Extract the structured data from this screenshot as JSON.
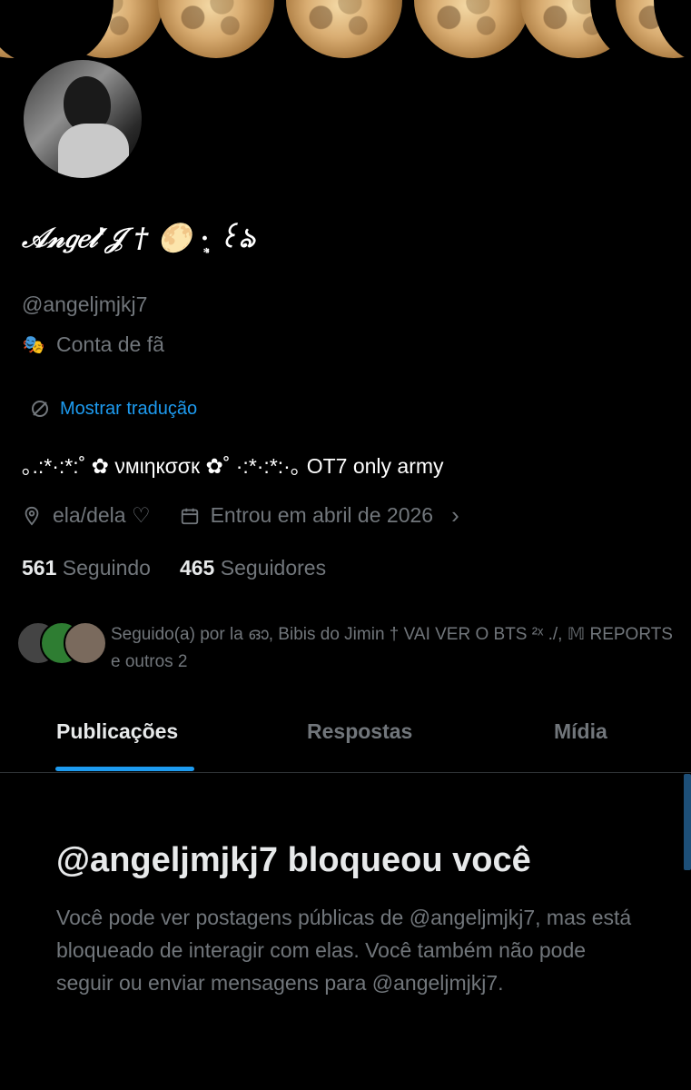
{
  "profile": {
    "display_name": "𝒜𝓃𝑔𝑒𝓁'𝒥 † 🌕 ·̩͙ ꒰ঌ",
    "handle": "@angeljmjkj7",
    "category": {
      "icon": "theater-mask-icon",
      "label": "Conta de fã"
    },
    "translate_label": "Mostrar tradução",
    "bio": "｡.:*·:*:˚ ✿ νмιηкσσк ✿˚ ·:*·:*:·｡ OT7  only army",
    "location": "ela/dela ♡",
    "joined": "Entrou em abril de 2026",
    "following_count": "561",
    "following_label": "Seguindo",
    "followers_count": "465",
    "followers_label": "Seguidores"
  },
  "followed_by": {
    "text": "Seguido(a) por la ഓ, Bibis do Jimin † VAI VER O BTS ²ˣ ./, 𝕄 REPORTS e outros 2",
    "avatar_colors": [
      "#333",
      "#2e7d32",
      "#7a6a5d"
    ]
  },
  "tabs": [
    {
      "label": "Publicações",
      "active": true
    },
    {
      "label": "Respostas",
      "active": false
    },
    {
      "label": "Mídia",
      "active": false
    }
  ],
  "blocked": {
    "title": "@angeljmjkj7 bloqueou você",
    "text": "Você pode ver postagens públicas de @angeljmjkj7, mas está bloqueado de interagir com elas. Você também não pode seguir ou enviar mensagens para @angeljmjkj7."
  },
  "colors": {
    "accent": "#1d9bf0",
    "background": "#000000",
    "muted": "#71767b",
    "text": "#e7e9ea"
  }
}
